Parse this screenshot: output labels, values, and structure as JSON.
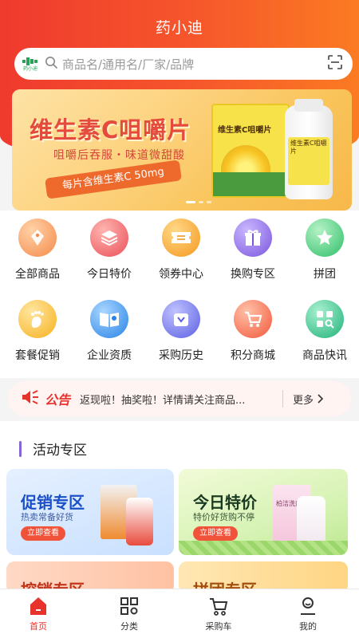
{
  "header": {
    "title": "药小迪",
    "brand_color": "#ef3a2e"
  },
  "search": {
    "logo_caption": "药小迪",
    "placeholder": "商品名/通用名/厂家/品牌",
    "search_icon": "search-icon",
    "scan_icon": "scan-icon"
  },
  "banner": {
    "headline": "维生素C咀嚼片",
    "subline": "咀嚼后吞服・味道微甜酸",
    "tag": "每片含维生素C 50mg",
    "box_label": "维生素C咀嚼片",
    "bottle_label": "维生素C咀嚼片"
  },
  "menu": [
    {
      "label": "全部商品",
      "icon": "tag-icon",
      "color": "#f7a86a"
    },
    {
      "label": "今日特价",
      "icon": "layers-icon",
      "color": "#f06a6a"
    },
    {
      "label": "领券中心",
      "icon": "coupon-icon",
      "color": "#fbad3b"
    },
    {
      "label": "换购专区",
      "icon": "gift-icon",
      "color": "#8a6be3"
    },
    {
      "label": "拼团",
      "icon": "star-icon",
      "color": "#4fcf7a"
    },
    {
      "label": "套餐促销",
      "icon": "foot-icon",
      "color": "#fbc045"
    },
    {
      "label": "企业资质",
      "icon": "book-icon",
      "color": "#3d9bf0"
    },
    {
      "label": "采购历史",
      "icon": "bag-icon",
      "color": "#6f72e8"
    },
    {
      "label": "积分商城",
      "icon": "cart-icon",
      "color": "#f7704a"
    },
    {
      "label": "商品快讯",
      "icon": "news-icon",
      "color": "#37c28a"
    }
  ],
  "notice": {
    "tag": "公告",
    "message": "返现啦！抽奖啦！详情请关注商品...",
    "more": "更多"
  },
  "activity": {
    "title": "活动专区",
    "cards": [
      {
        "title": "促销专区",
        "subtitle": "热卖常备好货",
        "button": "立即查看"
      },
      {
        "title": "今日特价",
        "subtitle": "特价好货购不停",
        "button": "立即查看",
        "product_label": "柏洁洗剂"
      },
      {
        "title": "控销专区"
      },
      {
        "title": "拼团专区"
      }
    ]
  },
  "tabbar": [
    {
      "label": "首页",
      "icon": "home-icon",
      "active": true
    },
    {
      "label": "分类",
      "icon": "grid-icon",
      "active": false
    },
    {
      "label": "采购车",
      "icon": "cart-icon",
      "active": false
    },
    {
      "label": "我的",
      "icon": "user-icon",
      "active": false
    }
  ]
}
